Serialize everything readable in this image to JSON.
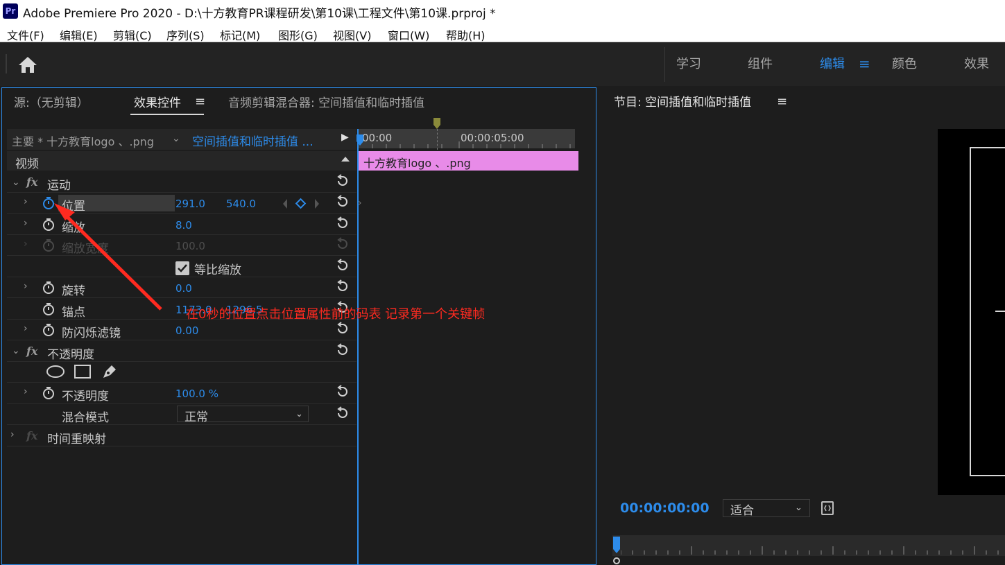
{
  "window": {
    "app_logo": "Pr",
    "title": "Adobe Premiere Pro 2020 - D:\\十方教育PR课程研发\\第10课\\工程文件\\第10课.prproj *"
  },
  "menu": [
    "文件(F)",
    "编辑(E)",
    "剪辑(C)",
    "序列(S)",
    "标记(M)",
    "图形(G)",
    "视图(V)",
    "窗口(W)",
    "帮助(H)"
  ],
  "workspaces": {
    "tabs": [
      "学习",
      "组件",
      "编辑",
      "颜色",
      "效果"
    ],
    "active": "编辑",
    "menu_icon": "≡"
  },
  "left_panel": {
    "tabs": [
      "源:（无剪辑）",
      "效果控件",
      "音频剪辑混合器: 空间插值和临时插值"
    ],
    "active_tab": "效果控件",
    "tab_menu_icon": "≡",
    "clip_master": "主要 * 十方教育logo 、.png",
    "clip_sequence": "空间插值和临时插值 ...",
    "video_section": "视频",
    "motion": {
      "fx": "fx",
      "name": "运动",
      "position": {
        "label": "位置",
        "x": "291.0",
        "y": "540.0"
      },
      "scale": {
        "label": "缩放",
        "value": "8.0"
      },
      "scale_width": {
        "label": "缩放宽度",
        "value": "100.0"
      },
      "uniform_scale": {
        "label": "等比缩放",
        "checked": true
      },
      "rotation": {
        "label": "旋转",
        "value": "0.0"
      },
      "anchor": {
        "label": "锚点",
        "x": "1173.0",
        "y": "1296.5"
      },
      "anti_flicker": {
        "label": "防闪烁滤镜",
        "value": "0.00"
      }
    },
    "opacity": {
      "fx": "fx",
      "name": "不透明度",
      "value_label": "不透明度",
      "value": "100.0 %",
      "blend_label": "混合模式",
      "blend_value": "正常"
    },
    "time_remap": {
      "fx": "fx",
      "name": "时间重映射"
    },
    "timeline": {
      "tc_start": "00:00",
      "tc_mid": "00:00:05:00",
      "clip_label": "十方教育logo 、.png",
      "clip_color": "#e88be8"
    }
  },
  "annotation": "在0秒的位置点击位置属性前的码表 记录第一个关键帧",
  "program": {
    "title": "节目: 空间插值和临时插值",
    "menu_icon": "≡",
    "timecode": "00:00:00:00",
    "fit": "适合"
  },
  "colors": {
    "accent": "#2d8ceb",
    "annotation": "#ff2a20",
    "clip": "#e88be8"
  }
}
